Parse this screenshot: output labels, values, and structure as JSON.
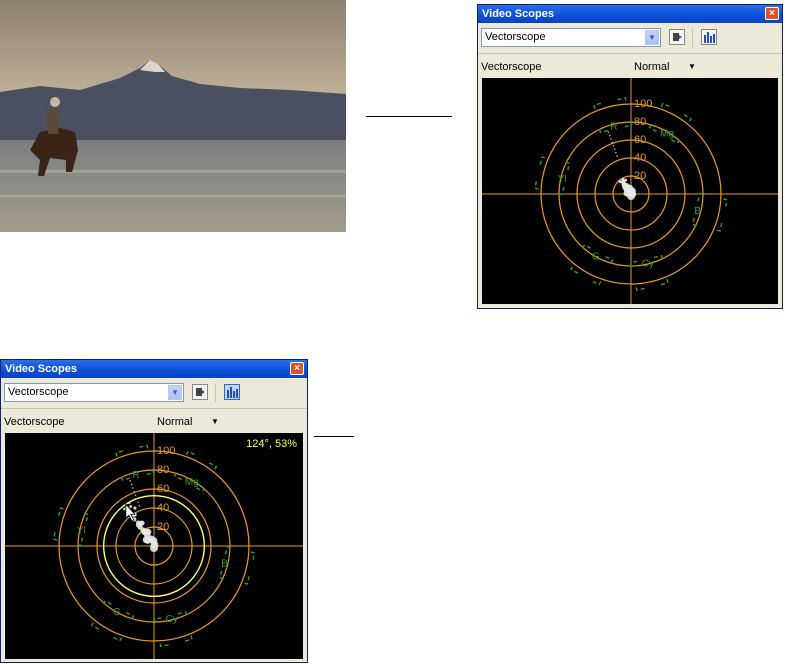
{
  "photo": {
    "description_icon": "beach-horse-rider-photo"
  },
  "window_top": {
    "title": "Video Scopes",
    "close_icon": "×",
    "scope_select_value": "Vectorscope",
    "scope_label": "Vectorscope",
    "mode_value": "Normal",
    "readout": ""
  },
  "window_bottom": {
    "title": "Video Scopes",
    "close_icon": "×",
    "scope_select_value": "Vectorscope",
    "scope_label": "Vectorscope",
    "mode_value": "Normal",
    "readout": "124°, 53%"
  },
  "vectorscope": {
    "ring_labels": [
      "100",
      "80",
      "60",
      "40",
      "20"
    ],
    "targets": [
      "R",
      "Mg",
      "B",
      "Cy",
      "G",
      "Yl"
    ]
  },
  "colors": {
    "graticule": "#e89a22",
    "target": "#2fa02f",
    "readout": "#ffff33",
    "highlight_ring": "#ffff66"
  }
}
